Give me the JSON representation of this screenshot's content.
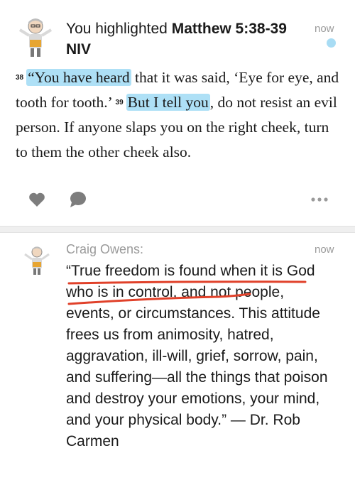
{
  "post1": {
    "header_prefix": "You highlighted ",
    "reference": "Matthew 5:38-39 NIV",
    "timestamp": "now",
    "verse": {
      "num38": "38",
      "open_quote": "“",
      "hl1": "You have heard",
      "text1": " that it was said, ‘Eye for eye, and tooth for tooth.’ ",
      "num39": "39",
      "hl2": "But I tell you",
      "text2": ", do not resist an evil person. If anyone slaps you on the right cheek, turn to them the other cheek also."
    },
    "actions": {
      "like_icon": "heart-icon",
      "comment_icon": "comment-bubble-icon",
      "more_icon": "more-ellipsis-icon"
    },
    "colors": {
      "highlight": "#aee0f6",
      "unread_dot": "#a8dcf4"
    }
  },
  "post2": {
    "author": "Craig Owens:",
    "timestamp": "now",
    "quote": "“True freedom is found when it is God who is in control, and not people, events, or circumstances. This attitude frees us from animosity, hatred, aggravation, ill-will, grief, sorrow, pain, and suffering—all the things that poison and destroy your emotions, your mind, and your physical body.” — Dr. Rob Carmen",
    "colors": {
      "underline_mark": "#e0412a"
    }
  }
}
